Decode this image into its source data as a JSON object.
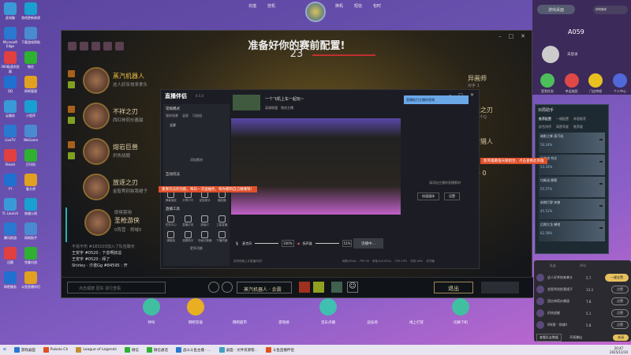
{
  "desktop_icons": [
    "此电脑",
    "游戏更新修改",
    "Microsoft Edge",
    "下载游戏帮助",
    "360极速浏览器",
    "微信",
    "QQ",
    "网吧管理",
    "云服务",
    "小程序",
    "LiveTV",
    "WeGame",
    "Steam",
    "打印机",
    "YY",
    "鲁大师",
    "TL Launch",
    "穿越火线",
    "腾讯网游",
    "网吧助手",
    "迅雷",
    "完美对战",
    "网吧服务",
    "斗鱼直播伴侣"
  ],
  "client_top": {
    "left": [
      "充值",
      "挂机"
    ],
    "right": [
      "换机",
      "短信",
      "包时"
    ]
  },
  "lol": {
    "title": "准备好你的赛前配置!",
    "timer": "23",
    "team": [
      {
        "name": "蒸汽机器人",
        "sub": "这人好杀快来拿头"
      },
      {
        "name": "不祥之刃",
        "sub": "西红柿煎炒酱甜"
      },
      {
        "name": "熔岩巨兽",
        "sub": "炽热战舰"
      },
      {
        "name": "放逐之刃",
        "sub": "金智秀别拍我裙子"
      },
      {
        "label": "即将禁用",
        "name": "圣枪游侠",
        "sub": "0阵营 · 领域0"
      }
    ],
    "enemy": [
      {
        "name": "异画师",
        "sub": "对手 1"
      },
      {
        "name": "魔法之刃",
        "sub": "在线找个Q"
      },
      {
        "name": "赏金猎人",
        "sub": "对手 3"
      },
      {
        "name": "对手 0",
        "sub": ""
      }
    ],
    "chat": [
      "不造不伤 #183103加入了队伍聊天",
      "王安宇 #0520 : 下去啊叔总",
      "王安宇 #0520 : 拜了",
      "Shirley · 汐诺Gg #84595 : 开"
    ],
    "chat_placeholder": "点击或按 回车 进行查看",
    "champion_select": "蒸汽机器人 · 余震",
    "exit": "退出"
  },
  "stream": {
    "app": "直播伴侣",
    "version": "6.5.0",
    "mode": "常规模式",
    "scenes_tabs": [
      "我的场景",
      "竖屏",
      "可选组"
    ],
    "source": "全屏",
    "add_source": "添加素材",
    "room_title": "一个飞机上车一起玩~",
    "room_tags": [
      "英雄联盟",
      "独创主播"
    ],
    "interact_title": "互动玩法",
    "interact": [
      "弹幕抽奖",
      "分享口令",
      "贴贴助手",
      "播放器"
    ],
    "tools_title": "直播工具",
    "tools": [
      "任务中心",
      "直播记录",
      "超级灯",
      "卫星直播",
      "弹幕姬",
      "观看助手",
      "场景切换器",
      "下播机器"
    ],
    "more": "更多功能",
    "mic_label": "麦克风",
    "mic_pct": "100%",
    "spk_label": "扬声器",
    "spk_pct": "51%",
    "effects": [
      "美颜",
      "录制",
      "设置"
    ],
    "live_btn": "连播中...",
    "banner": "重要玩法的功能，每日一次送抽奖，每你都和自己做赚钱！",
    "status": [
      "网络:0Kb/s",
      "FPS:30",
      "丢帧:0(0.00%)",
      "CPU:19%",
      "内存:46%",
      "未开播"
    ],
    "status_hint": "如何快速上手直播伴侣?",
    "right_hint": "请添加主播的直播素材",
    "right_btns": [
      "快速媒体",
      "设置"
    ],
    "promo": "直播助力主播的视频"
  },
  "helper": {
    "title": "对局助手",
    "tabs": [
      "推荐配置",
      "一键配置",
      "阵容推荐"
    ],
    "filters": [
      "综合排序",
      "高胜率度",
      "推荐度"
    ],
    "rows": [
      {
        "name": "暗影之拳 蒸汽机",
        "rate": "50.24%"
      },
      {
        "name": "坦克流 符文",
        "rate": "53.33%"
      },
      {
        "name": "均衡流 撕裂",
        "rate": "55.57%"
      },
      {
        "name": "前期打野 奔袭",
        "rate": "45.51%"
      },
      {
        "name": "后期大龙 撼地",
        "rate": "62.58%"
      }
    ],
    "red_note": "新英雄最强天赋组合，点击查看此英雄"
  },
  "side": {
    "desktop_btn": "游戏桌面",
    "notice": "网吧管家",
    "machine": "A059",
    "login": "未登录",
    "actions": [
      "签到任务",
      "幸运抽奖",
      "门店特权",
      "个人中心"
    ]
  },
  "rank": {
    "headers": [
      "队友",
      "评分"
    ],
    "rows": [
      {
        "n": "这人好杀快来拿头",
        "s": "5.7",
        "b": "一键全赞"
      },
      {
        "n": "金智秀别拍我裙子",
        "s": "13.3",
        "b": "点赞"
      },
      {
        "n": "西红柿煎炒酱甜",
        "s": "7.8",
        "b": "点赞"
      },
      {
        "n": "炽热战舰",
        "s": "5.1",
        "b": "点赞"
      },
      {
        "n": "0阵营 · 领域0",
        "s": "5.8",
        "b": "点赞"
      }
    ],
    "footer": [
      "查看队友数据",
      "不再弹出",
      "关闭"
    ]
  },
  "dock": [
    "呼叫",
    "网吧充值",
    "网吧超市",
    "游戏榜",
    "音乐点播",
    "竞技场",
    "线上打赏",
    "切换下机"
  ],
  "taskbar": {
    "apps": [
      "游戏桌面",
      "Pubolo Ch",
      "League of Legends",
      "微信",
      "微信通话",
      "战斗斗鱼主播 - ...",
      "桌面 - 文件资源管...",
      "斗鱼直播伴侣"
    ],
    "time": "20:47",
    "date": "2025/11/10"
  }
}
